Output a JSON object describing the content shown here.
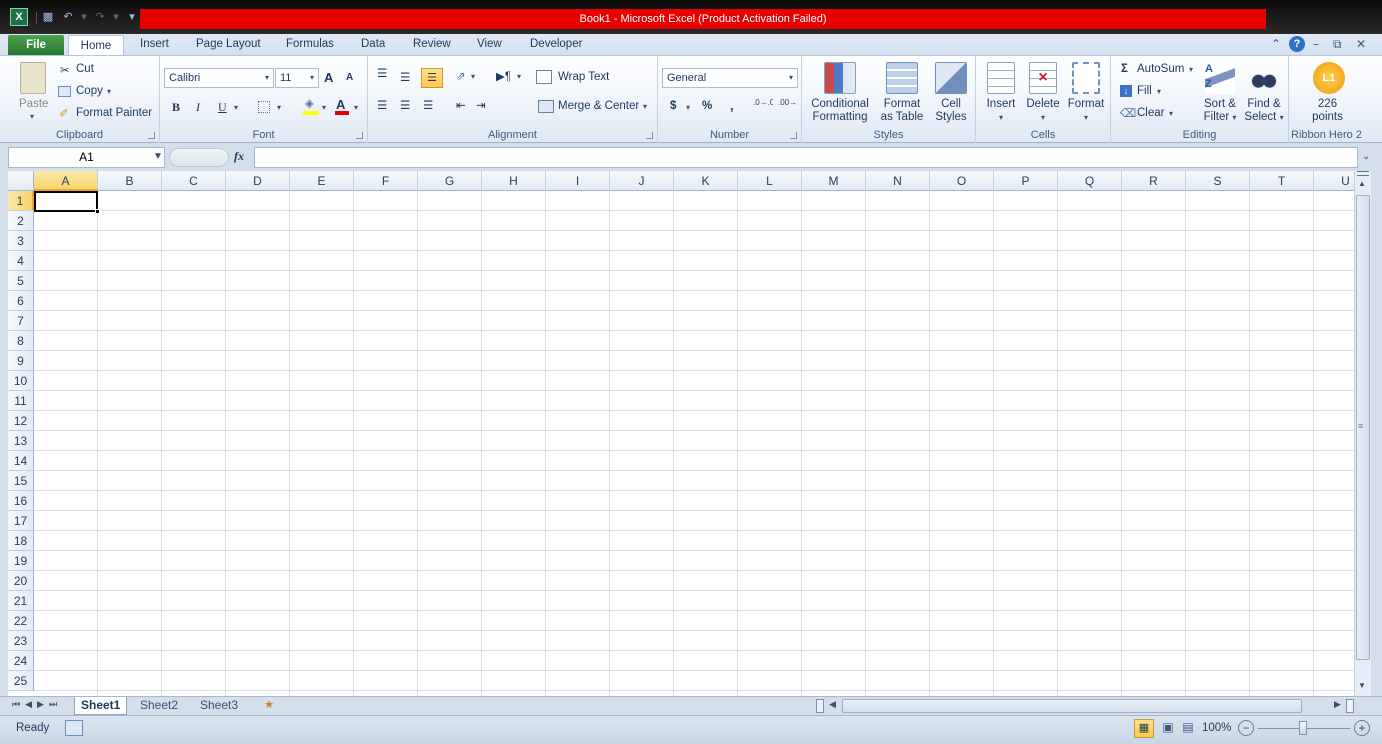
{
  "window": {
    "title": "Book1  -  Microsoft Excel (Product Activation Failed)",
    "app_icon": "X",
    "title_color": "#e80000"
  },
  "tabs": [
    "File",
    "Home",
    "Insert",
    "Page Layout",
    "Formulas",
    "Data",
    "Review",
    "View",
    "Developer"
  ],
  "ribbon": {
    "clipboard": {
      "paste": "Paste",
      "cut": "Cut",
      "copy": "Copy",
      "format_painter": "Format Painter",
      "label": "Clipboard"
    },
    "font": {
      "name": "Calibri",
      "size": "11",
      "bold": "B",
      "italic": "I",
      "underline": "U",
      "grow": "A",
      "shrink": "A",
      "font_color": "A",
      "label": "Font"
    },
    "alignment": {
      "wrap": "Wrap Text",
      "merge": "Merge & Center",
      "label": "Alignment"
    },
    "number": {
      "format": "General",
      "currency": "$",
      "percent": "%",
      "comma": ",",
      "inc_decimal": ".0→.00",
      "dec_decimal": ".00→.0",
      "label": "Number"
    },
    "styles": {
      "cond1": "Conditional",
      "cond2": "Formatting",
      "fmt1": "Format",
      "fmt2": "as Table",
      "cell1": "Cell",
      "cell2": "Styles",
      "label": "Styles"
    },
    "cells": {
      "insert": "Insert",
      "delete": "Delete",
      "format": "Format",
      "label": "Cells"
    },
    "editing": {
      "autosum": "AutoSum",
      "fill": "Fill",
      "clear": "Clear",
      "sort1": "Sort &",
      "sort2": "Filter",
      "find1": "Find &",
      "find2": "Select",
      "label": "Editing"
    },
    "hero": {
      "badge": "L1",
      "points1": "226",
      "points2": "points",
      "label": "Ribbon Hero 2"
    }
  },
  "formula_bar": {
    "name_box": "A1",
    "fx": "fx",
    "value": ""
  },
  "grid": {
    "columns": [
      "A",
      "B",
      "C",
      "D",
      "E",
      "F",
      "G",
      "H",
      "I",
      "J",
      "K",
      "L",
      "M",
      "N",
      "O",
      "P",
      "Q",
      "R",
      "S",
      "T",
      "U"
    ],
    "rows": [
      "1",
      "2",
      "3",
      "4",
      "5",
      "6",
      "7",
      "8",
      "9",
      "10",
      "11",
      "12",
      "13",
      "14",
      "15",
      "16",
      "17",
      "18",
      "19",
      "20",
      "21",
      "22",
      "23",
      "24",
      "25"
    ],
    "selected_cell": "A1"
  },
  "sheets": [
    "Sheet1",
    "Sheet2",
    "Sheet3"
  ],
  "active_sheet": "Sheet1",
  "status": {
    "mode": "Ready",
    "zoom": "100%"
  }
}
